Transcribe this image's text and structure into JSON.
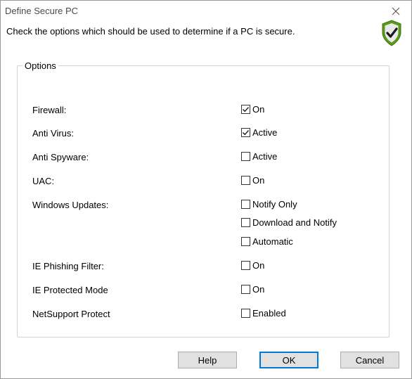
{
  "window": {
    "title": "Define Secure PC"
  },
  "icons": {
    "close": "close-icon",
    "shield": "shield-check-icon"
  },
  "instruction": "Check the options which should be used to determine if a PC is secure.",
  "group_label": "Options",
  "options": [
    {
      "label": "Firewall:",
      "checks": [
        {
          "text": "On",
          "checked": true
        }
      ]
    },
    {
      "label": "Anti Virus:",
      "checks": [
        {
          "text": "Active",
          "checked": true
        }
      ]
    },
    {
      "label": "Anti Spyware:",
      "checks": [
        {
          "text": "Active",
          "checked": false
        }
      ]
    },
    {
      "label": "UAC:",
      "checks": [
        {
          "text": "On",
          "checked": false
        }
      ]
    },
    {
      "label": "Windows Updates:",
      "checks": [
        {
          "text": "Notify Only",
          "checked": false
        },
        {
          "text": "Download and Notify",
          "checked": false
        },
        {
          "text": "Automatic",
          "checked": false
        }
      ]
    },
    {
      "label": "IE Phishing Filter:",
      "checks": [
        {
          "text": "On",
          "checked": false
        }
      ]
    },
    {
      "label": "IE Protected Mode",
      "checks": [
        {
          "text": "On",
          "checked": false
        }
      ]
    },
    {
      "label": "NetSupport Protect",
      "checks": [
        {
          "text": "Enabled",
          "checked": false
        }
      ]
    }
  ],
  "buttons": {
    "help": "Help",
    "ok": "OK",
    "cancel": "Cancel"
  },
  "colors": {
    "shield_green": "#5a9a1a",
    "focus_blue": "#0078d7"
  }
}
